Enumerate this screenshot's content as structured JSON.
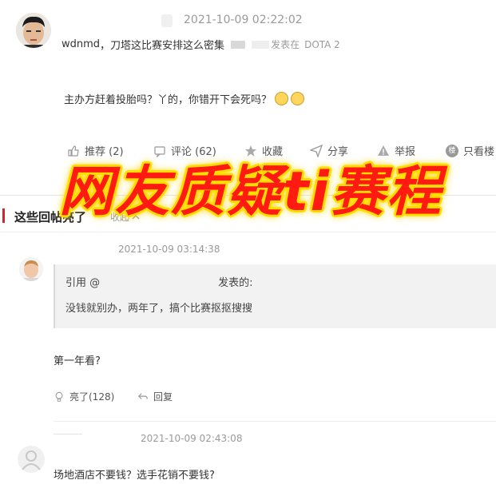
{
  "original_post": {
    "timestamp": "2021-10-09 02:22:02",
    "author": "wdnmd",
    "title": "，刀塔这比赛安排这么密集",
    "board_text": "发表在",
    "board_name": "DOTA 2",
    "body": "主办方赶着投胎吗？丫的，你错开下会死吗？",
    "actions": {
      "recommend": "推荐 (2)",
      "comment": "评论 (62)",
      "favorite": "收藏",
      "share": "分享",
      "report": "举报",
      "only_author": "只看楼"
    }
  },
  "overlay_title": "网友质疑ti赛程",
  "hot_replies": {
    "title": "这些回帖亮了",
    "collapse": "收起"
  },
  "reply1": {
    "timestamp": "2021-10-09 03:14:38",
    "quote_prefix": "引用 @",
    "quote_suffix": "发表的:",
    "quote_text": "没钱就别办，两年了，搞个比赛抠抠搜搜",
    "body": "第一年看?",
    "like": "亮了(128)",
    "reply": "回复"
  },
  "reply2": {
    "timestamp": "2021-10-09 02:43:08",
    "body": "场地酒店不要钱？选手花销不要钱?"
  }
}
